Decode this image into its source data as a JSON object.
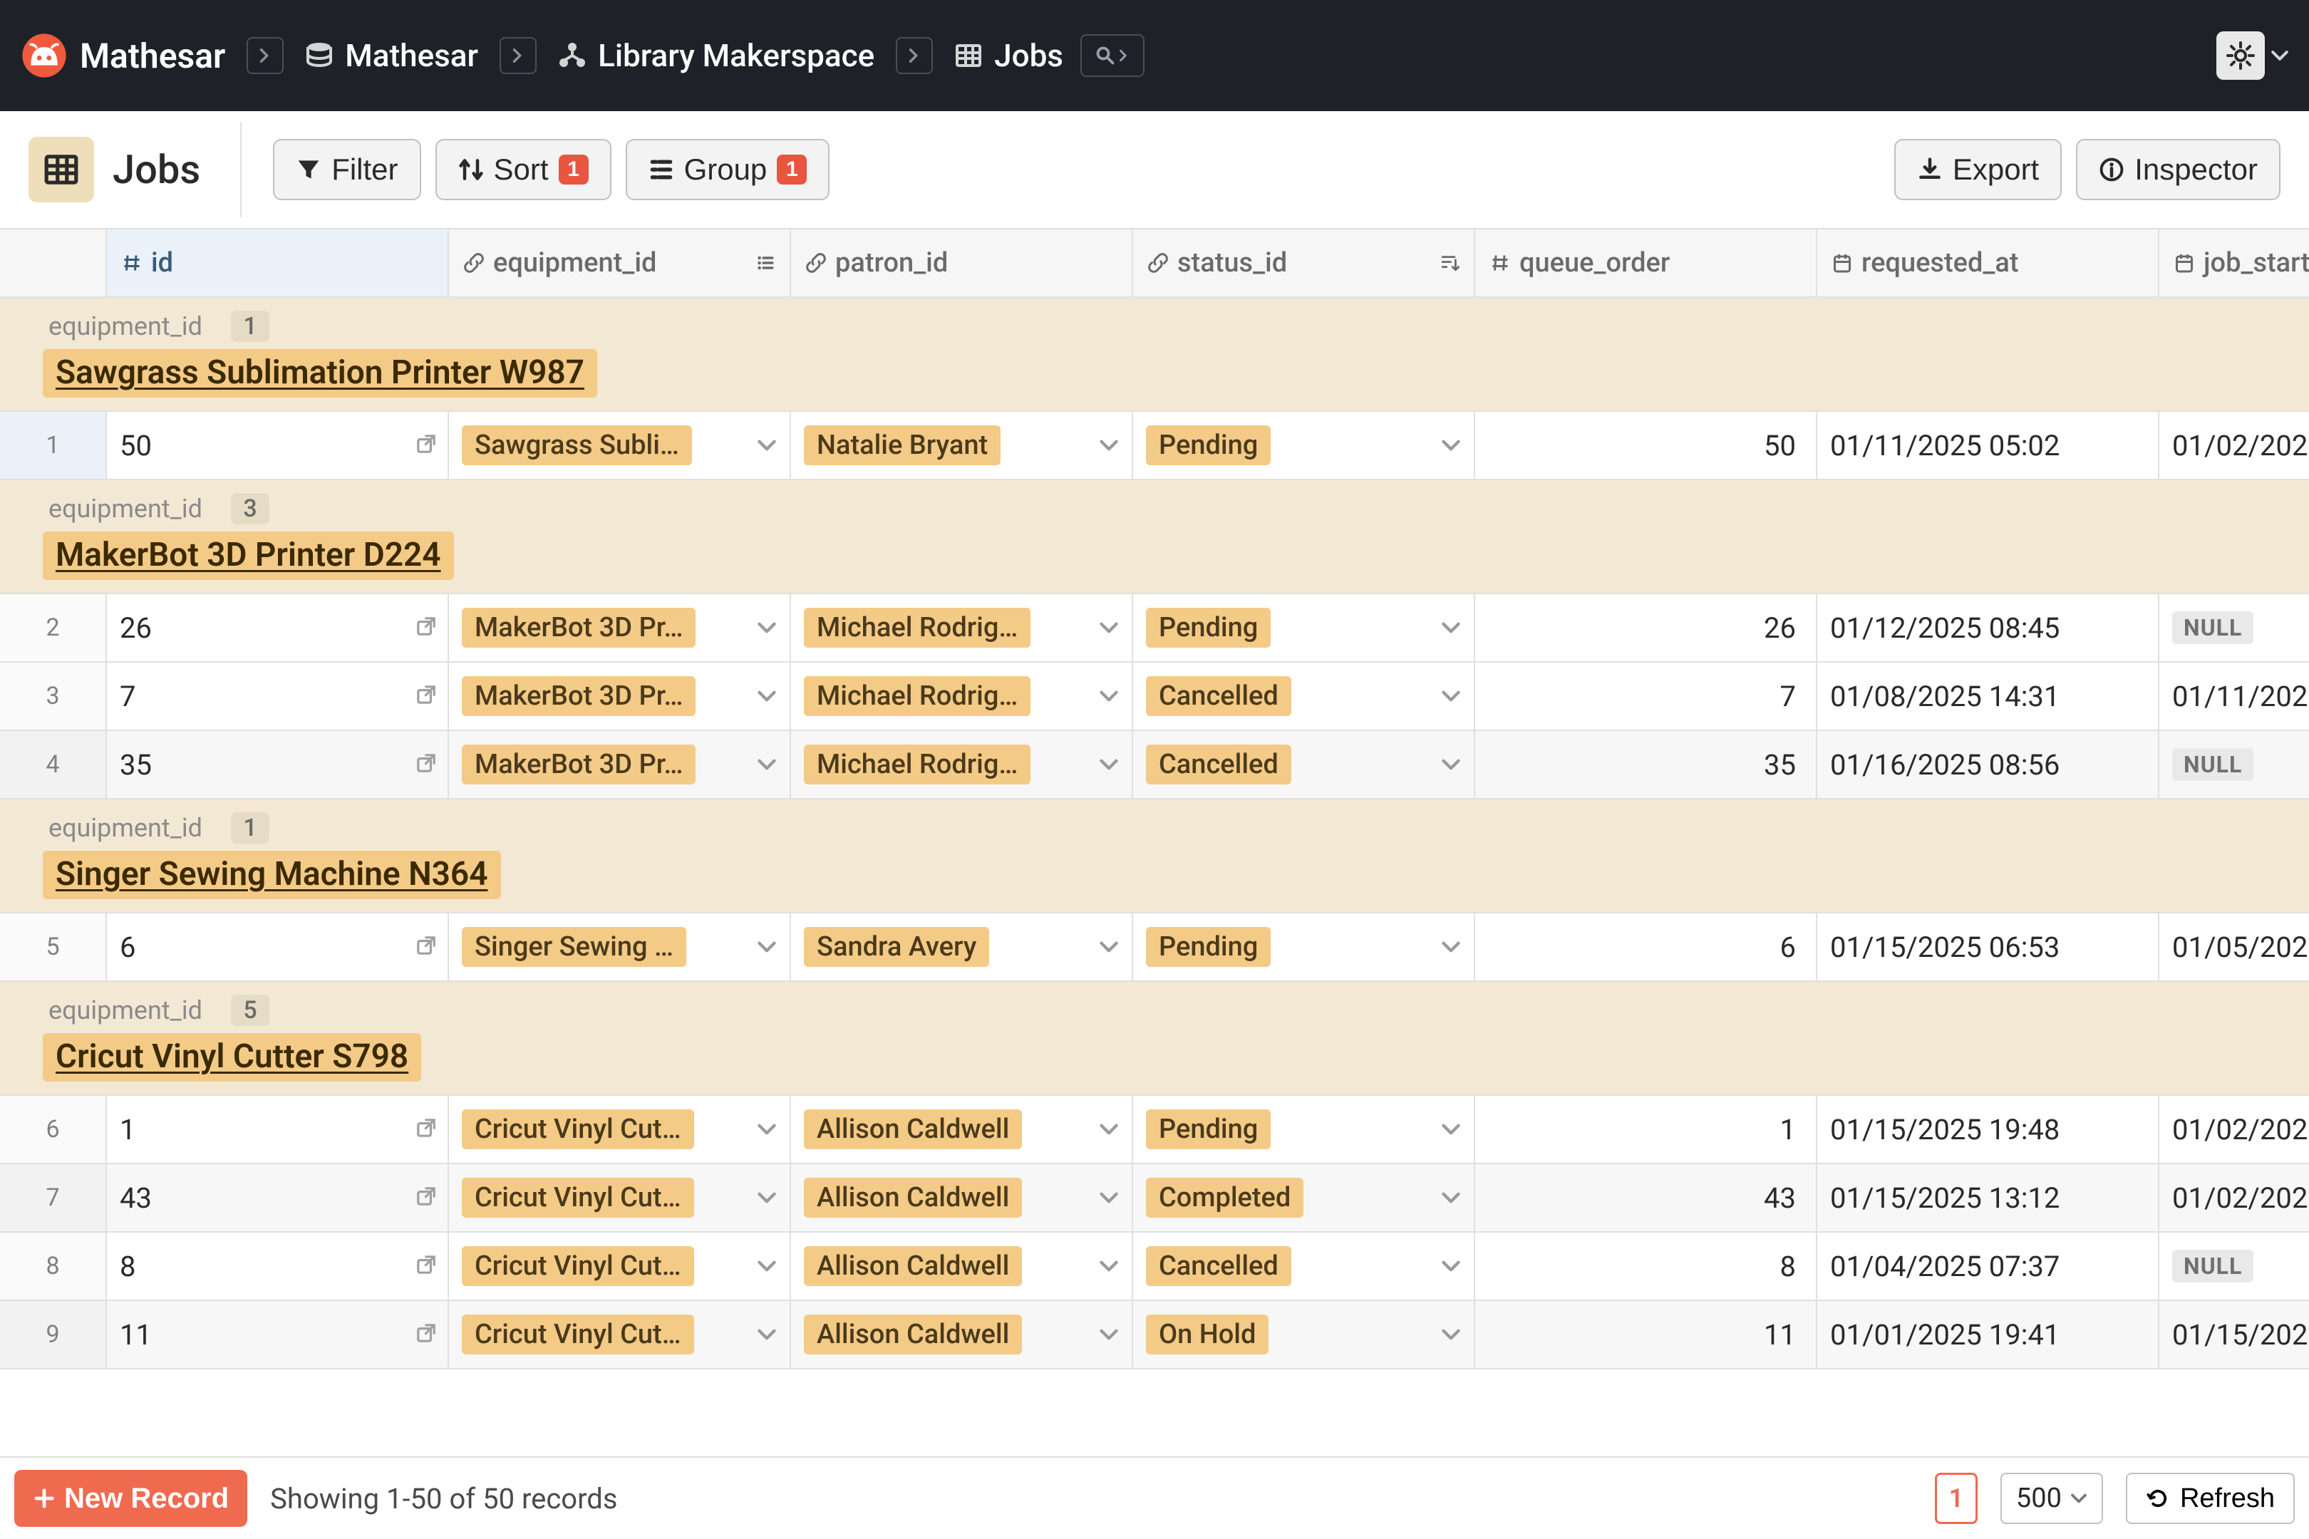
{
  "app_name": "Mathesar",
  "breadcrumbs": {
    "db": "Mathesar",
    "schema": "Library Makerspace",
    "table": "Jobs"
  },
  "page_title": "Jobs",
  "toolbar": {
    "filter_label": "Filter",
    "sort_label": "Sort",
    "sort_count": "1",
    "group_label": "Group",
    "group_count": "1",
    "export_label": "Export",
    "inspector_label": "Inspector"
  },
  "columns": [
    {
      "name": "id",
      "type": "number"
    },
    {
      "name": "equipment_id",
      "type": "link"
    },
    {
      "name": "patron_id",
      "type": "link"
    },
    {
      "name": "status_id",
      "type": "link"
    },
    {
      "name": "queue_order",
      "type": "number"
    },
    {
      "name": "requested_at",
      "type": "date"
    },
    {
      "name": "job_start",
      "type": "date"
    }
  ],
  "group_field_label": "equipment_id",
  "groups": [
    {
      "value": "Sawgrass Sublimation Printer W987",
      "count": "1",
      "rows": [
        {
          "n": "1",
          "id": "50",
          "equipment": "Sawgrass Subli…",
          "patron": "Natalie Bryant",
          "status": "Pending",
          "queue": "50",
          "requested": "01/11/2025 05:02",
          "start": "01/02/202",
          "start_null": false,
          "alt": false,
          "firstsel": true
        }
      ]
    },
    {
      "value": "MakerBot 3D Printer D224",
      "count": "3",
      "rows": [
        {
          "n": "2",
          "id": "26",
          "equipment": "MakerBot 3D Pr…",
          "patron": "Michael Rodrig…",
          "status": "Pending",
          "queue": "26",
          "requested": "01/12/2025 08:45",
          "start": "NULL",
          "start_null": true,
          "alt": false
        },
        {
          "n": "3",
          "id": "7",
          "equipment": "MakerBot 3D Pr…",
          "patron": "Michael Rodrig…",
          "status": "Cancelled",
          "queue": "7",
          "requested": "01/08/2025 14:31",
          "start": "01/11/202",
          "start_null": false,
          "alt": false
        },
        {
          "n": "4",
          "id": "35",
          "equipment": "MakerBot 3D Pr…",
          "patron": "Michael Rodrig…",
          "status": "Cancelled",
          "queue": "35",
          "requested": "01/16/2025 08:56",
          "start": "NULL",
          "start_null": true,
          "alt": true
        }
      ]
    },
    {
      "value": "Singer Sewing Machine N364",
      "count": "1",
      "rows": [
        {
          "n": "5",
          "id": "6",
          "equipment": "Singer Sewing …",
          "patron": "Sandra Avery",
          "status": "Pending",
          "queue": "6",
          "requested": "01/15/2025 06:53",
          "start": "01/05/202",
          "start_null": false,
          "alt": false
        }
      ]
    },
    {
      "value": "Cricut Vinyl Cutter S798",
      "count": "5",
      "rows": [
        {
          "n": "6",
          "id": "1",
          "equipment": "Cricut Vinyl Cut…",
          "patron": "Allison Caldwell",
          "status": "Pending",
          "queue": "1",
          "requested": "01/15/2025 19:48",
          "start": "01/02/202",
          "start_null": false,
          "alt": false
        },
        {
          "n": "7",
          "id": "43",
          "equipment": "Cricut Vinyl Cut…",
          "patron": "Allison Caldwell",
          "status": "Completed",
          "queue": "43",
          "requested": "01/15/2025 13:12",
          "start": "01/02/202",
          "start_null": false,
          "alt": true
        },
        {
          "n": "8",
          "id": "8",
          "equipment": "Cricut Vinyl Cut…",
          "patron": "Allison Caldwell",
          "status": "Cancelled",
          "queue": "8",
          "requested": "01/04/2025 07:37",
          "start": "NULL",
          "start_null": true,
          "alt": false
        },
        {
          "n": "9",
          "id": "11",
          "equipment": "Cricut Vinyl Cut…",
          "patron": "Allison Caldwell",
          "status": "On Hold",
          "queue": "11",
          "requested": "01/01/2025 19:41",
          "start": "01/15/202",
          "start_null": false,
          "alt": true
        }
      ]
    }
  ],
  "footer": {
    "new_record_label": "New Record",
    "status": "Showing 1-50 of 50 records",
    "page": "1",
    "page_size": "500",
    "refresh_label": "Refresh"
  }
}
